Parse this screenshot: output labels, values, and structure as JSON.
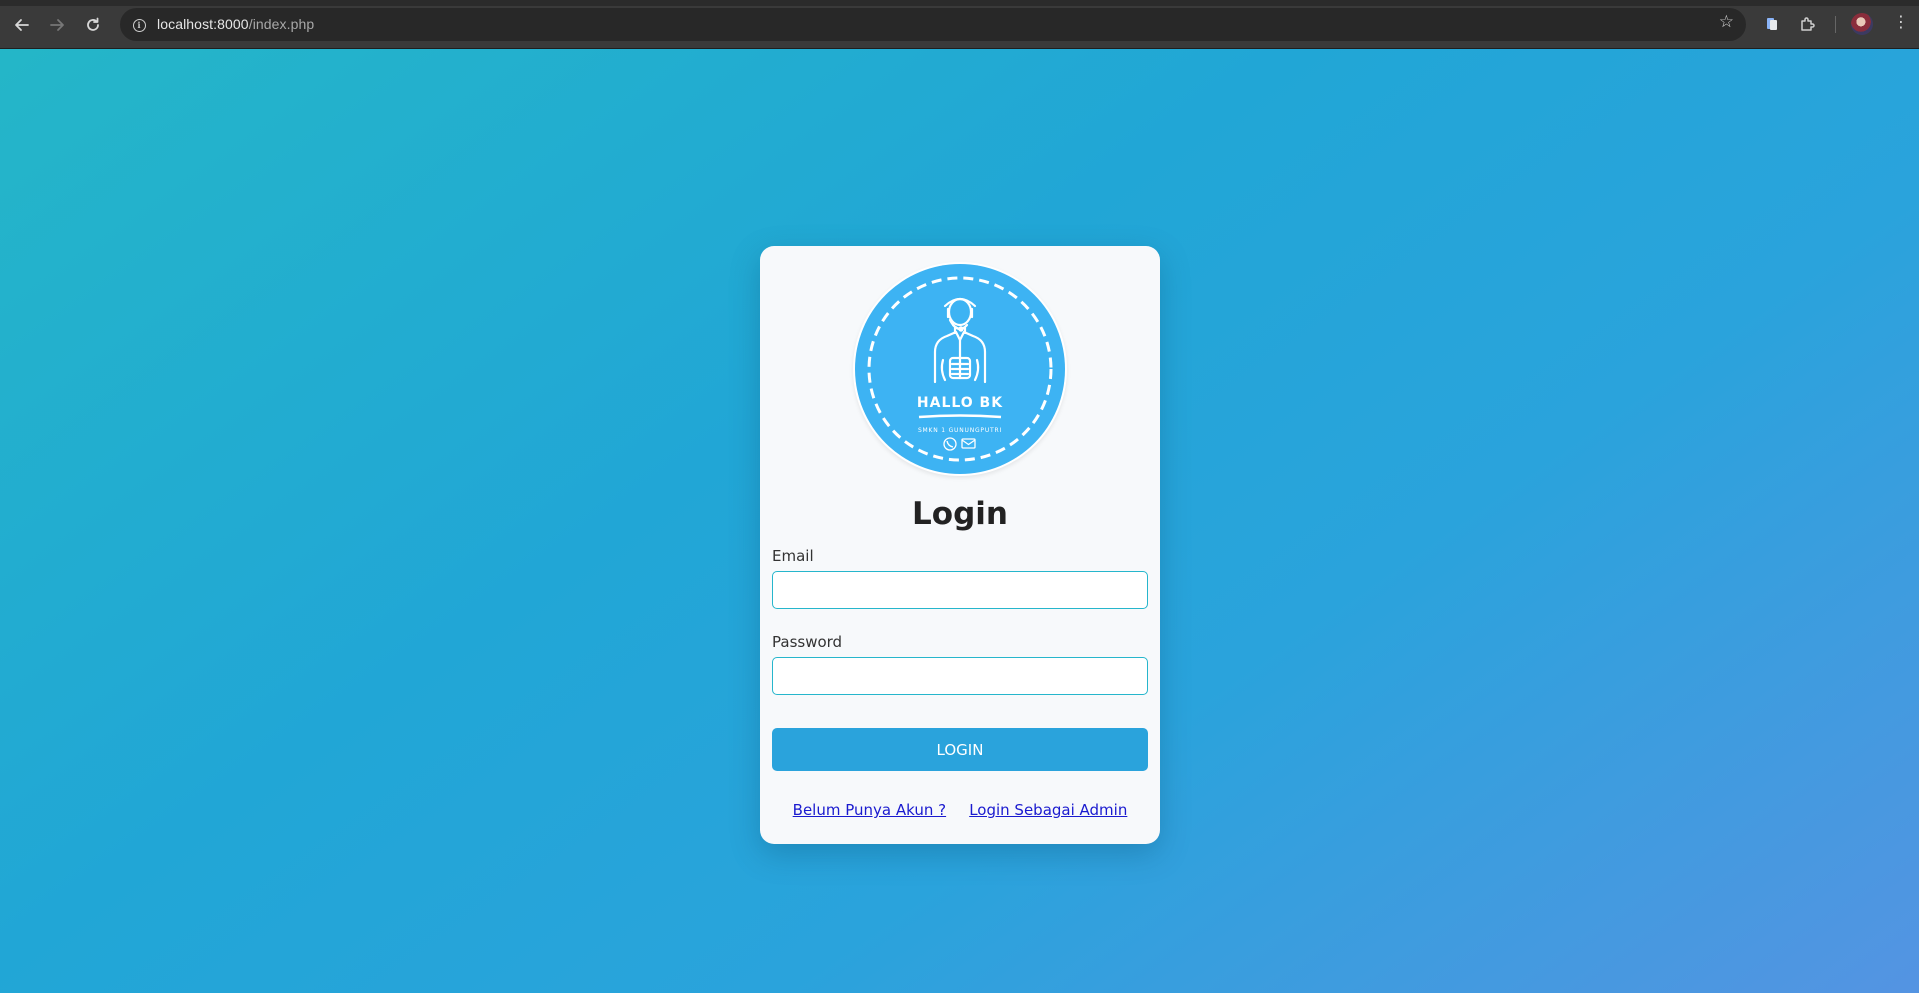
{
  "browser": {
    "url_host": "localhost:8000",
    "url_path": "/index.php",
    "back_icon": "arrow-left-icon",
    "forward_icon": "arrow-right-icon",
    "reload_icon": "reload-icon",
    "site_info_icon": "info-icon",
    "bookmark_icon": "star-icon",
    "menu_icon": "kebab-menu-icon"
  },
  "logo": {
    "title": "HALLO BK",
    "subtitle": "SMKN 1 GUNUNGPUTRI",
    "background_color": "#3db3f3"
  },
  "login": {
    "title": "Login",
    "email_label": "Email",
    "email_value": "",
    "password_label": "Password",
    "password_value": "",
    "button_label": "LOGIN",
    "register_link": "Belum Punya Akun ?",
    "admin_link": "Login Sebagai Admin"
  },
  "colors": {
    "accent": "#2aa3dc",
    "input_border": "#26b6cc",
    "link": "#1a1acf"
  }
}
